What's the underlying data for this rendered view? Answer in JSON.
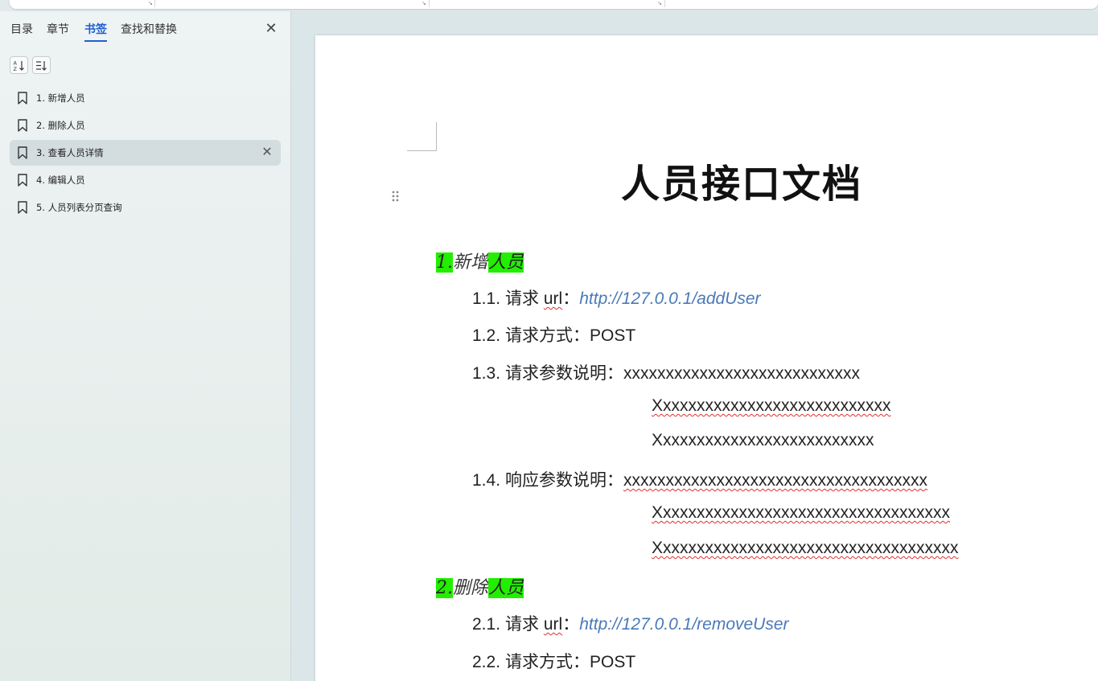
{
  "nav": {
    "tabs": [
      "目录",
      "章节",
      "书签",
      "查找和替换"
    ],
    "active_tab": "书签",
    "bookmarks": [
      {
        "label": "1. 新增人员"
      },
      {
        "label": "2. 删除人员"
      },
      {
        "label": "3. 查看人员详情"
      },
      {
        "label": "4. 编辑人员"
      },
      {
        "label": "5. 人员列表分页查询"
      }
    ]
  },
  "document": {
    "title": "人员接口文档",
    "sections": [
      {
        "number": "1.",
        "name_plain": "新增",
        "name_highlight": "人员",
        "items": [
          {
            "number": "1.1.",
            "label": "请求",
            "key": "url",
            "sep": "：",
            "value": "http://127.0.0.1/addUser"
          },
          {
            "number": "1.2.",
            "label": "请求方式：",
            "value": "POST"
          },
          {
            "number": "1.3.",
            "label": "请求参数说明：",
            "value": "xxxxxxxxxxxxxxxxxxxxxxxxxxxx",
            "continuation": [
              "Xxxxxxxxxxxxxxxxxxxxxxxxxxxx",
              "Xxxxxxxxxxxxxxxxxxxxxxxxxx"
            ]
          },
          {
            "number": "1.4.",
            "label": "响应参数说明：",
            "value": "xxxxxxxxxxxxxxxxxxxxxxxxxxxxxxxxxxxx",
            "continuation": [
              "Xxxxxxxxxxxxxxxxxxxxxxxxxxxxxxxxxxx",
              "Xxxxxxxxxxxxxxxxxxxxxxxxxxxxxxxxxxxx"
            ]
          }
        ]
      },
      {
        "number": "2.",
        "name_plain": "删除",
        "name_highlight": "人员",
        "items": [
          {
            "number": "2.1.",
            "label": "请求",
            "key": "url",
            "sep": "：",
            "value": "http://127.0.0.1/removeUser"
          },
          {
            "number": "2.2.",
            "label": "请求方式：",
            "value": "POST"
          }
        ]
      }
    ]
  },
  "colors": {
    "accent": "#1f5fd0",
    "highlight": "#22ee00",
    "link": "#4a79b8",
    "spellcheck": "#e03030"
  }
}
